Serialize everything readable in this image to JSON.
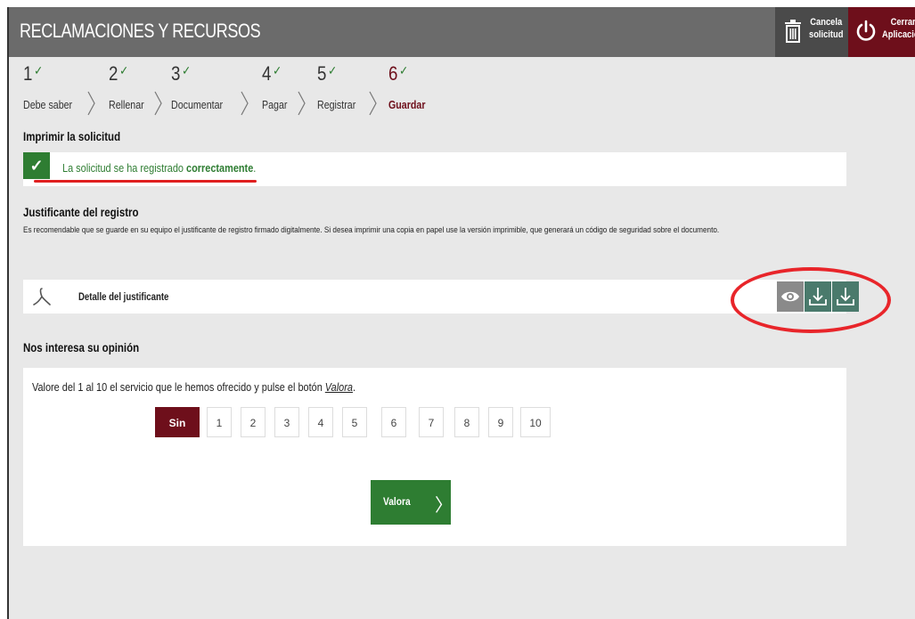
{
  "header": {
    "title": "RECLAMACIONES Y RECURSOS",
    "cancel_label_1": "Cancela",
    "cancel_label_2": "solicitud",
    "close_label_1": "Cerrar",
    "close_label_2": "Aplicación"
  },
  "steps": [
    {
      "num": "1",
      "check": "✓",
      "label": "Debe saber"
    },
    {
      "num": "2",
      "check": "✓",
      "label": "Rellenar"
    },
    {
      "num": "3",
      "check": "✓",
      "label": "Documentar"
    },
    {
      "num": "4",
      "check": "✓",
      "label": "Pagar"
    },
    {
      "num": "5",
      "check": "✓",
      "label": "Registrar"
    },
    {
      "num": "6",
      "check": "✓",
      "label": "Guardar"
    }
  ],
  "print": {
    "heading": "Imprimir la solicitud",
    "success_prefix": "La solicitud se ha registrado ",
    "success_bold": "correctamente",
    "success_suffix": "."
  },
  "receipt": {
    "heading": "Justificante del registro",
    "description": "Es recomendable que se guarde en su equipo el justificante de registro firmado digitalmente. Si desea imprimir una copia en papel use la versión imprimible, que generará un código de seguridad sobre el documento.",
    "doc_label": "Detalle del justificante",
    "icons": [
      "eye-icon",
      "download-icon",
      "download-icon"
    ]
  },
  "opinion": {
    "heading": "Nos interesa su opinión",
    "instruction_prefix": "Valore del 1 al 10 el servicio que le hemos ofrecido y pulse el botón ",
    "instruction_link": "Valora",
    "instruction_suffix": ".",
    "selected": "Sin valorar",
    "options": [
      "1",
      "2",
      "3",
      "4",
      "5",
      "6",
      "7",
      "8",
      "9",
      "10"
    ],
    "submit_label": "Valora",
    "submit_arrow": "〉"
  },
  "colors": {
    "accent": "#6e0f1b",
    "success": "#2e7d32",
    "annotation": "#e8252a"
  }
}
